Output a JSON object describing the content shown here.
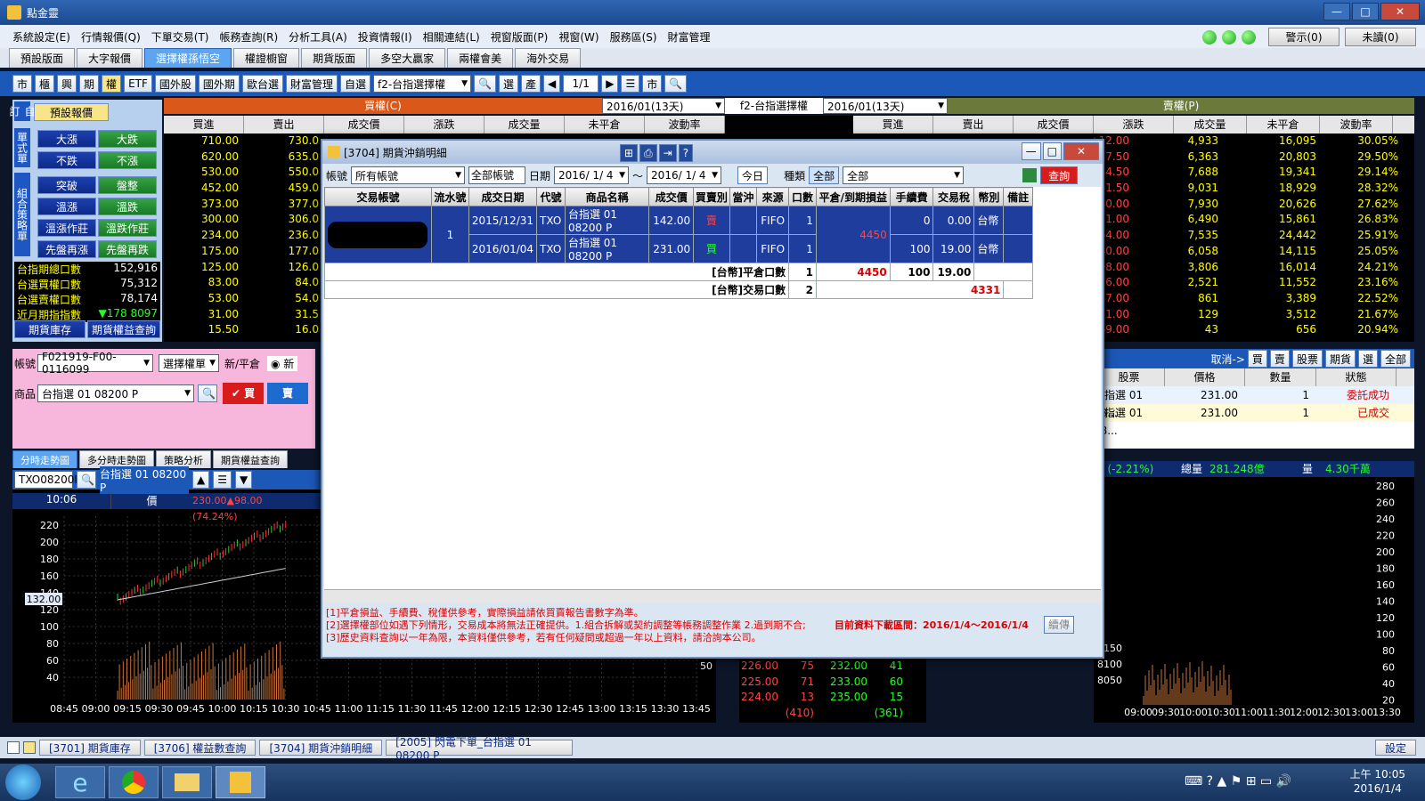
{
  "app": {
    "title": "點金靈"
  },
  "menu": [
    "系統設定(E)",
    "行情報價(Q)",
    "下單交易(T)",
    "帳務查詢(R)",
    "分析工具(A)",
    "投資情報(I)",
    "相關連結(L)",
    "視窗版面(P)",
    "視窗(W)",
    "服務區(S)",
    "財富管理"
  ],
  "status": {
    "alert": "警示(0)",
    "unread": "未讀(0)"
  },
  "tabs": [
    "預設版面",
    "大字報價",
    "選擇權孫悟空",
    "權證櫥窗",
    "期貨版面",
    "多空大贏家",
    "兩權會美",
    "海外交易"
  ],
  "toolbar": {
    "buttons": [
      "市",
      "櫃",
      "興",
      "期",
      "權",
      "ETF",
      "國外股",
      "國外期",
      "歐台選",
      "財富管理",
      "自選"
    ],
    "product": "f2-台指選擇權",
    "search": "選",
    "produce": "產",
    "page": "1/1",
    "market": "市"
  },
  "left": {
    "labels": [
      "自訂",
      "單式單",
      "組合策略單"
    ],
    "preset": "預設報價",
    "buttons": [
      "大漲",
      "大跌",
      "不跌",
      "不漲",
      "突破",
      "盤整",
      "溫漲",
      "溫跌",
      "溫漲作莊",
      "溫跌作莊",
      "先盤再漲",
      "先盤再跌"
    ],
    "stats": [
      {
        "k": "台指期總口數",
        "v": "152,916"
      },
      {
        "k": "台選買權口數",
        "v": "75,312"
      },
      {
        "k": "台選賣權口數",
        "v": "78,174"
      },
      {
        "k": "近月期指指數",
        "v": "▼178 8097"
      }
    ],
    "bottom": [
      "期貨庫存",
      "期貨權益查詢"
    ]
  },
  "quote": {
    "call": "買權(C)",
    "put": "賣權(P)",
    "expiry_left": "2016/01(13天)",
    "product": "f2-台指選擇權",
    "expiry_right": "2016/01(13天)",
    "headers_left": [
      "買進",
      "賣出",
      "成交價",
      "漲跌",
      "成交量",
      "未平倉",
      "波動率"
    ],
    "headers_right": [
      "買進",
      "賣出",
      "成交價",
      "漲跌",
      "成交量",
      "未平倉",
      "波動率"
    ],
    "call_rows": [
      [
        "710.00",
        "730.0"
      ],
      [
        "620.00",
        "635.0"
      ],
      [
        "530.00",
        "550.0"
      ],
      [
        "452.00",
        "459.0"
      ],
      [
        "373.00",
        "377.0"
      ],
      [
        "300.00",
        "306.0"
      ],
      [
        "234.00",
        "236.0"
      ],
      [
        "175.00",
        "177.0"
      ],
      [
        "125.00",
        "126.0"
      ],
      [
        "83.00",
        "84.0"
      ],
      [
        "53.00",
        "54.0"
      ],
      [
        "31.00",
        "31.5"
      ],
      [
        "15.50",
        "16.0"
      ]
    ],
    "put_rows": [
      [
        "▲12.00",
        "4,933",
        "16,095",
        "30.05%"
      ],
      [
        "▲17.50",
        "6,363",
        "20,803",
        "29.50%"
      ],
      [
        "▲24.50",
        "7,688",
        "19,341",
        "29.14%"
      ],
      [
        "▲31.50",
        "9,031",
        "18,929",
        "28.32%"
      ],
      [
        "▲40.00",
        "7,930",
        "20,626",
        "27.62%"
      ],
      [
        "▲51.00",
        "6,490",
        "15,861",
        "26.83%"
      ],
      [
        "▲64.00",
        "7,535",
        "24,442",
        "25.91%"
      ],
      [
        "▲80.00",
        "6,058",
        "14,115",
        "25.05%"
      ],
      [
        "▲98.00",
        "3,806",
        "16,014",
        "24.21%"
      ],
      [
        "▲116.00",
        "2,521",
        "11,552",
        "23.16%"
      ],
      [
        "▲137.00",
        "861",
        "3,389",
        "22.52%"
      ],
      [
        "▲151.00",
        "129",
        "3,512",
        "21.67%"
      ],
      [
        "▲169.00",
        "43",
        "656",
        "20.94%"
      ]
    ]
  },
  "order": {
    "account_label": "帳號",
    "account": "F021919-F00-0116099",
    "order_type": "選擇權單",
    "newclose_label": "新/平倉",
    "new": "新",
    "product_label": "商品",
    "product": "台指選 01 08200 P",
    "buy": "買",
    "sell": "賣"
  },
  "orders_right": {
    "cancel": "取消->",
    "buttons": [
      "買",
      "賣",
      "股票",
      "期貨",
      "選",
      "全部"
    ],
    "headers": [
      "股票",
      "價格",
      "數量",
      "狀態"
    ],
    "rows": [
      [
        "台指選 01 08...",
        "231.00",
        "1",
        "委託成功"
      ],
      [
        "台指選 01 08...",
        "231.00",
        "1",
        "已成交"
      ]
    ]
  },
  "chart": {
    "tabs": [
      "分時走勢圖",
      "多分時走勢圖",
      "策略分析",
      "期貨權益查詢"
    ],
    "code": "TXO08200P",
    "name": "台指選 01 08200 P",
    "time": "10:06",
    "price_label": "價",
    "price_info": "230.00▲98.00 (74.24%)",
    "marker": "132.00",
    "yticks": [
      "220",
      "200",
      "180",
      "160",
      "140",
      "120",
      "100",
      "80",
      "60",
      "40"
    ],
    "xticks": [
      "08:45",
      "09:00",
      "09:15",
      "09:30",
      "09:45",
      "10:00",
      "10:15",
      "10:30",
      "10:45",
      "11:00",
      "11:15",
      "11:30",
      "11:45",
      "12:00",
      "12:15",
      "12:30",
      "12:45",
      "13:00",
      "13:15",
      "13:30",
      "13:45"
    ],
    "vol_tick": "50"
  },
  "rightchart": {
    "change": "3 (-2.21%)",
    "total_label": "總量",
    "total": "281.248億",
    "vol_label": "量",
    "vol": "4.30千萬",
    "yticks": [
      "280",
      "260",
      "240",
      "220",
      "200",
      "180",
      "160",
      "140",
      "120",
      "100",
      "80",
      "60",
      "40",
      "20"
    ],
    "yleft": [
      "8150",
      "8100",
      "8050"
    ],
    "xticks": [
      "09:00",
      "09:30",
      "10:00",
      "10:30",
      "11:00",
      "11:30",
      "12:00",
      "12:30",
      "13:00",
      "13:30"
    ]
  },
  "bidask": [
    [
      "226.00",
      "75",
      "232.00",
      "41"
    ],
    [
      "225.00",
      "71",
      "233.00",
      "60"
    ],
    [
      "224.00",
      "13",
      "235.00",
      "15"
    ]
  ],
  "bidask_total": [
    "(410)",
    "(361)"
  ],
  "dialog": {
    "title": "[3704] 期貨沖銷明細",
    "account_label": "帳號",
    "account": "所有帳號",
    "account_all": "全部帳號",
    "date_label": "日期",
    "date_from": "2016/ 1/ 4",
    "tilde": "～",
    "date_to": "2016/ 1/ 4",
    "today": "今日",
    "kind_label": "種類",
    "kind": "全部",
    "kind2": "全部",
    "query": "查詢",
    "headers": [
      "交易帳號",
      "流水號",
      "成交日期",
      "代號",
      "商品名稱",
      "成交價",
      "買賣別",
      "當沖",
      "來源",
      "口數",
      "平倉/到期損益",
      "手續費",
      "交易稅",
      "幣別",
      "備註"
    ],
    "rows": [
      {
        "seq": "1",
        "date": "2015/12/31",
        "code": "TXO",
        "name": "台指選 01 08200 P",
        "price": "142.00",
        "side": "賣",
        "src": "FIFO",
        "qty": "1",
        "pl": "4450",
        "fee": "0",
        "tax": "0.00",
        "cur": "台幣"
      },
      {
        "seq": "",
        "date": "2016/01/04",
        "code": "TXO",
        "name": "台指選 01 08200 P",
        "price": "231.00",
        "side": "買",
        "src": "FIFO",
        "qty": "1",
        "pl": "",
        "fee": "100",
        "tax": "19.00",
        "cur": "台幣"
      }
    ],
    "sum1_label": "[台幣]平倉口數",
    "sum1_qty": "1",
    "sum1_pl": "4450",
    "sum1_fee": "100",
    "sum1_tax": "19.00",
    "sum2_label": "[台幣]交易口數",
    "sum2_qty": "2",
    "sum2_net": "4331",
    "notes": [
      "[1]平倉損益、手續費、稅僅供參考，實際損益請依買賣報告書數字為準。",
      "[2]選擇權部位如遇下列情形，交易成本將無法正確提供。1.組合拆解或契約調整等帳務調整作業 2.過到期不合;",
      "[3]歷史資料查詢以一年為限，本資料僅供參考，若有任何疑問或超過一年以上資料，請洽詢本公司。"
    ],
    "range_note": "目前資料下載區間：2016/1/4～2016/1/4",
    "continue": "續傳"
  },
  "dock": [
    "[3701] 期貨庫存",
    "[3706] 權益數查詢",
    "[3704] 期貨沖銷明細",
    "[2005] 閃電下單_台指選 01 08200 P"
  ],
  "dock_settings": "設定",
  "clock": {
    "time": "上午 10:05",
    "date": "2016/1/4"
  }
}
